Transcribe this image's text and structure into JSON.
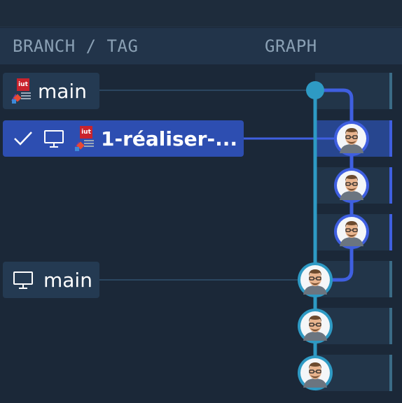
{
  "header": {
    "branch_tag": "BRANCH / TAG",
    "graph": "GRAPH"
  },
  "refs": [
    {
      "label": "main",
      "kind": "remote",
      "icon": "iut-logo-icon"
    },
    {
      "label": "1-réaliser-...",
      "kind": "checked-out",
      "icons": [
        "check-icon",
        "monitor-icon",
        "iut-logo-icon"
      ]
    },
    {
      "label": "main",
      "kind": "local",
      "icon": "monitor-icon"
    }
  ],
  "iut_logo_text": "iut",
  "colors": {
    "background": "#1b2838",
    "header": "#22344a",
    "active_branch": "#2d4eb1",
    "main_line": "#2e9ac4",
    "feature_line": "#3f5fe0"
  },
  "commits": [
    {
      "branch": "main",
      "avatar": "avatar-icon"
    },
    {
      "branch": "1-réaliser-...",
      "avatar": "avatar-icon"
    },
    {
      "branch": "1-réaliser-...",
      "avatar": "avatar-icon"
    },
    {
      "branch": "1-réaliser-...",
      "avatar": "avatar-icon"
    },
    {
      "branch": "main",
      "avatar": "avatar-icon"
    },
    {
      "branch": "main",
      "avatar": "avatar-icon"
    },
    {
      "branch": "main",
      "avatar": "avatar-icon"
    }
  ]
}
